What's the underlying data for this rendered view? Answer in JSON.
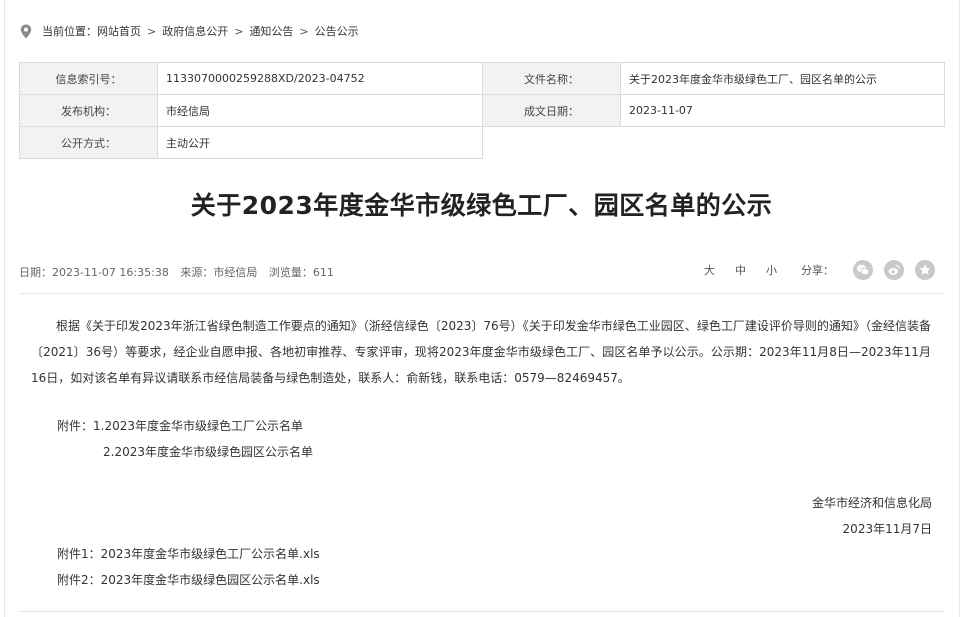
{
  "breadcrumb": {
    "prefix": "当前位置：",
    "items": [
      "网站首页",
      "政府信息公开",
      "通知公告",
      "公告公示"
    ],
    "separator": ">"
  },
  "meta": {
    "index_label": "信息索引号：",
    "index_value": "1133070000259288XD/2023-04752",
    "doc_name_label": "文件名称：",
    "doc_name_value": "关于2023年度金华市级绿色工厂、园区名单的公示",
    "publisher_label": "发布机构：",
    "publisher_value": "市经信局",
    "date_label": "成文日期：",
    "date_value": "2023-11-07",
    "open_label": "公开方式：",
    "open_value": "主动公开"
  },
  "article": {
    "title": "关于2023年度金华市级绿色工厂、园区名单的公示",
    "date_text": "日期：2023-11-07 16:35:38",
    "source_text": "来源：市经信局",
    "views_text": "浏览量：611",
    "body": "根据《关于印发2023年浙江省绿色制造工作要点的通知》（浙经信绿色〔2023〕76号）《关于印发金华市绿色工业园区、绿色工厂建设评价导则的通知》（金经信装备〔2021〕36号）等要求，经企业自愿申报、各地初审推荐、专家评审，现将2023年度金华市级绿色工厂、园区名单予以公示。公示期：2023年11月8日—2023年11月16日，如对该名单有异议请联系市经信局装备与绿色制造处，联系人：俞新钱，联系电话：0579—82469457。",
    "attach_line1": "附件：1.2023年度金华市级绿色工厂公示名单",
    "attach_line2": "2.2023年度金华市级绿色园区公示名单",
    "signature_org": "金华市经济和信息化局",
    "signature_date": "2023年11月7日",
    "file1": "附件1：2023年度金华市级绿色工厂公示名单.xls",
    "file2": "附件2：2023年度金华市级绿色园区公示名单.xls"
  },
  "tools": {
    "font_large": "大",
    "font_medium": "中",
    "font_small": "小",
    "share_label": "分享：",
    "share_icons": [
      "wechat-icon",
      "weibo-icon",
      "qzone-icon"
    ]
  }
}
